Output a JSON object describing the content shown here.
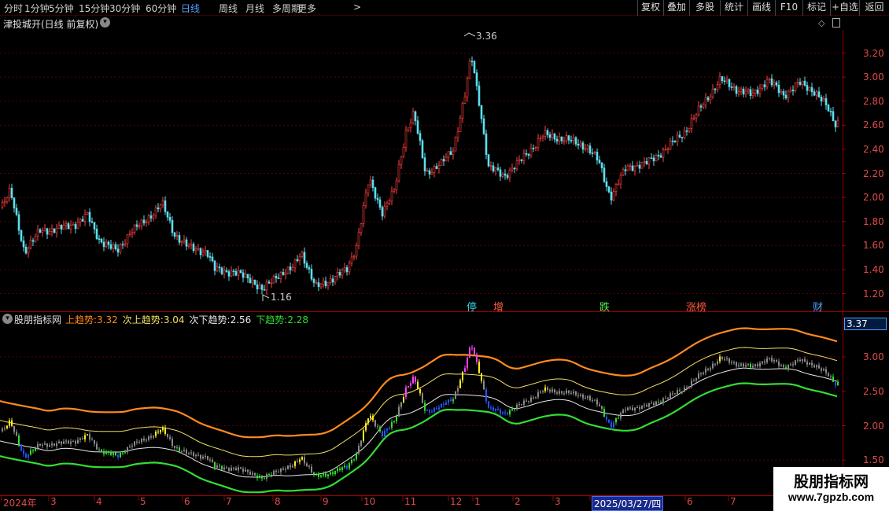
{
  "toolbar": {
    "periods": [
      "分时",
      "1分钟",
      "5分钟",
      "15分钟",
      "30分钟",
      "60分钟",
      "日线",
      "周线",
      "月线",
      "多周期",
      "更多"
    ],
    "active_period": "日线",
    "buttons": [
      "复权",
      "叠加",
      "多股",
      "统计",
      "画线",
      "F10",
      "标记",
      "+自选",
      "返回"
    ]
  },
  "price_panel": {
    "title": "津投城开(日线 前复权)",
    "high_label": "3.36",
    "low_label": "1.16",
    "y_ticks": [
      "3.20",
      "3.00",
      "2.80",
      "2.60",
      "2.40",
      "2.20",
      "2.00",
      "1.80",
      "1.60",
      "1.40",
      "1.20"
    ],
    "events": [
      {
        "text": "停",
        "color": "#33d6e0"
      },
      {
        "text": "增",
        "color": "#ff5a3c"
      },
      {
        "text": "跌",
        "color": "#55ee55"
      },
      {
        "text": "涨榜",
        "color": "#ff5a3c"
      },
      {
        "text": "财",
        "color": "#4ea3ff"
      }
    ],
    "colors": {
      "up": "#ff4040",
      "down": "#5ce0f0"
    }
  },
  "indicator_panel": {
    "name": "股朋指标网",
    "legend": [
      {
        "label": "上趋势:",
        "value": "3.32",
        "color": "#ff8a1e"
      },
      {
        "label": "次上趋势:",
        "value": "3.04",
        "color": "#f0e060"
      },
      {
        "label": "次下趋势:",
        "value": "2.56",
        "color": "#e8e8e8"
      },
      {
        "label": "下趋势:",
        "value": "2.28",
        "color": "#33dd33"
      }
    ],
    "current_value": "3.37",
    "y_ticks": [
      "3.00",
      "2.50",
      "2.00",
      "1.50"
    ]
  },
  "time_axis": {
    "labels": [
      "2024年",
      "3",
      "4",
      "5",
      "6",
      "7",
      "8",
      "9",
      "10",
      "11",
      "12",
      "1",
      "2",
      "3",
      "2025/03/27/四",
      "6",
      "7"
    ]
  },
  "watermark": {
    "title": "股朋指标网",
    "url": "www.7gpzb.com"
  }
}
